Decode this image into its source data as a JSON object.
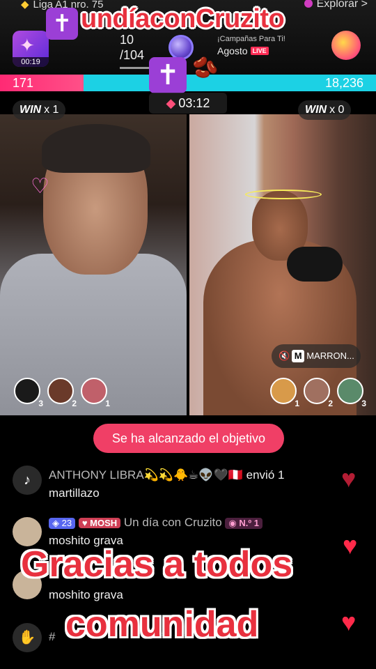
{
  "header": {
    "league": "Liga A1 nro. 75",
    "explore": "Explorar",
    "timer": "00:19",
    "stat_top": "10",
    "stat_bottom": "/104",
    "campaign_title": "¡Campañas Para Ti!",
    "campaign_month": "Agosto",
    "live_label": "LIVE"
  },
  "overlay": {
    "title": "undíaconCruzito",
    "cross_glyph": "✝",
    "beans": "🫘",
    "caption_line1": "Gracias a todos",
    "caption_line2": "comunidad"
  },
  "battle": {
    "left_score": "171",
    "right_score": "18,236",
    "countdown": "03:12",
    "win_label": "WIN",
    "left_wins": "x 1",
    "right_wins": "x 0",
    "left_contributors": [
      "3",
      "2",
      "1"
    ],
    "right_contributors": [
      "1",
      "2",
      "3"
    ],
    "sound_tag": "MARRON..."
  },
  "goal_message": "Se ha alcanzado el objetivo",
  "chat": [
    {
      "name": "ANTHONY LIBRA💫💫🐥☕👽🖤🇵🇪",
      "action": "envió 1",
      "message": "martillazo"
    },
    {
      "level": "23",
      "fan_badge": "MOSH",
      "name": "Un día con Cruzito",
      "rank": "N.º 1",
      "message": "moshito grava"
    },
    {
      "name": "",
      "message": "moshito grava"
    },
    {
      "name": "#",
      "message": ""
    }
  ],
  "colors": {
    "pink": "#fe2c55",
    "cyan": "#1cd1e4",
    "overlay_red": "#e8303e"
  }
}
